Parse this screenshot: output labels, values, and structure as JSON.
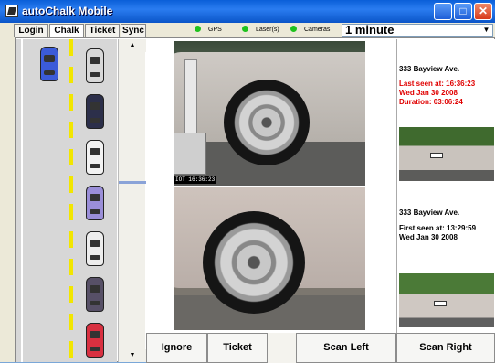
{
  "window": {
    "title": "autoChalk Mobile"
  },
  "tabs": [
    {
      "label": "Login",
      "active": false
    },
    {
      "label": "Chalk",
      "active": true
    },
    {
      "label": "Ticket",
      "active": false
    },
    {
      "label": "Sync",
      "active": false
    }
  ],
  "indicators": [
    {
      "label": "GPS",
      "status": "green"
    },
    {
      "label": "Laser(s)",
      "status": "green"
    },
    {
      "label": "Cameras",
      "status": "green"
    }
  ],
  "interval": {
    "selected": "1 minute"
  },
  "street_cars": [
    {
      "color": "#3b5bd9",
      "lane": "left"
    },
    {
      "color": "#d8d8d8",
      "lane": "right"
    },
    {
      "color": "#2c2f4a",
      "lane": "right"
    },
    {
      "color": "#f2f2f2",
      "lane": "right"
    },
    {
      "color": "#9a8ed8",
      "lane": "right"
    },
    {
      "color": "#ededed",
      "lane": "right"
    },
    {
      "color": "#575067",
      "lane": "right"
    },
    {
      "color": "#d83040",
      "lane": "right"
    }
  ],
  "cameras": {
    "top_timestamp": "IOT 16:36:23"
  },
  "info": {
    "top": {
      "address": "333 Bayview Ave.",
      "line1": "Last seen at: 16:36:23",
      "line2": "Wed Jan 30 2008",
      "line3": "Duration: 03:06:24",
      "color": "#e00000"
    },
    "bottom": {
      "address": "333 Bayview Ave.",
      "line1": "First seen at: 13:29:59",
      "line2": "Wed Jan 30 2008",
      "color": "#000000"
    }
  },
  "actions": {
    "ignore": "Ignore",
    "ticket": "Ticket",
    "scan_left": "Scan Left",
    "scan_right": "Scan Right"
  }
}
